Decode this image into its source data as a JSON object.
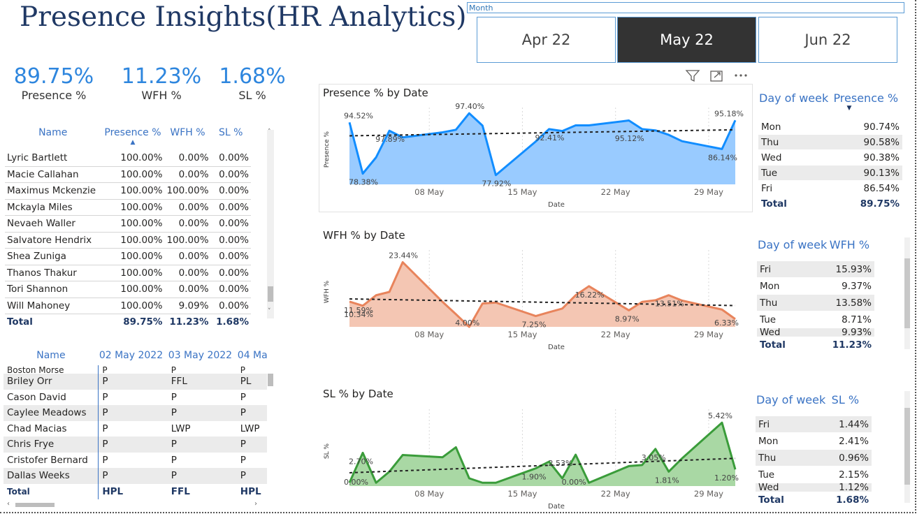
{
  "title": "Presence Insights(HR Analytics)",
  "month_slicer": {
    "label": "Month",
    "options": [
      "Apr 22",
      "May 22",
      "Jun 22"
    ],
    "selected": "May 22"
  },
  "kpis": [
    {
      "value": "89.75%",
      "label": "Presence %"
    },
    {
      "value": "11.23%",
      "label": "WFH %"
    },
    {
      "value": "1.68%",
      "label": "SL %"
    }
  ],
  "employee_table": {
    "columns": [
      "Name",
      "Presence %",
      "WFH %",
      "SL %"
    ],
    "rows": [
      [
        "Lyric Bartlett",
        "100.00%",
        "0.00%",
        "0.00%"
      ],
      [
        "Macie Callahan",
        "100.00%",
        "0.00%",
        "0.00%"
      ],
      [
        "Maximus Mckenzie",
        "100.00%",
        "100.00%",
        "0.00%"
      ],
      [
        "Mckayla Miles",
        "100.00%",
        "0.00%",
        "0.00%"
      ],
      [
        "Nevaeh Waller",
        "100.00%",
        "0.00%",
        "0.00%"
      ],
      [
        "Salvatore Hendrix",
        "100.00%",
        "100.00%",
        "0.00%"
      ],
      [
        "Shea Zuniga",
        "100.00%",
        "0.00%",
        "0.00%"
      ],
      [
        "Thanos Thakur",
        "100.00%",
        "0.00%",
        "0.00%"
      ],
      [
        "Tori Shannon",
        "100.00%",
        "0.00%",
        "0.00%"
      ],
      [
        "Will Mahoney",
        "100.00%",
        "9.09%",
        "0.00%"
      ]
    ],
    "total": [
      "Total",
      "89.75%",
      "11.23%",
      "1.68%"
    ]
  },
  "attendance_matrix": {
    "columns": [
      "Name",
      "02 May 2022",
      "03 May 2022",
      "04 Ma"
    ],
    "rows": [
      [
        "Boston Morse",
        "P",
        "P",
        "P"
      ],
      [
        "Briley Orr",
        "P",
        "FFL",
        "PL"
      ],
      [
        "Cason David",
        "P",
        "P",
        "P"
      ],
      [
        "Caylee Meadows",
        "P",
        "P",
        "P"
      ],
      [
        "Chad Macias",
        "P",
        "LWP",
        "LWP"
      ],
      [
        "Chris Frye",
        "P",
        "P",
        "P"
      ],
      [
        "Cristofer Bernard",
        "P",
        "P",
        "P"
      ],
      [
        "Dallas Weeks",
        "P",
        "P",
        "P"
      ]
    ],
    "total": [
      "Total",
      "HPL",
      "FFL",
      "HPL"
    ]
  },
  "chart_data": [
    {
      "type": "area",
      "title": "Presence % by Date",
      "xlabel": "Date",
      "ylabel": "Presence %",
      "x_ticks": [
        "08 May",
        "15 May",
        "22 May",
        "29 May"
      ],
      "color": "#118dff",
      "fill": "#99cbff",
      "ylim": [
        75,
        97
      ],
      "x_day_range": [
        2,
        31
      ],
      "x": [
        2,
        3,
        4,
        5,
        6,
        9,
        10,
        11,
        12,
        13,
        16,
        17,
        18,
        19,
        20,
        23,
        24,
        25,
        26,
        27,
        30,
        31
      ],
      "values": [
        94.52,
        78.38,
        83.5,
        91.89,
        89.8,
        91.4,
        92.2,
        97.4,
        93.5,
        77.92,
        88.5,
        92.41,
        91.8,
        93.6,
        93.6,
        95.12,
        92.4,
        92.0,
        90.6,
        88.6,
        86.14,
        95.18
      ],
      "point_labels": [
        {
          "x": 2,
          "y": 94.52,
          "text": "94.52%"
        },
        {
          "x": 3,
          "y": 78.38,
          "text": "78.38%"
        },
        {
          "x": 5,
          "y": 91.89,
          "text": "97.89%"
        },
        {
          "x": 11,
          "y": 97.4,
          "text": "97.40%"
        },
        {
          "x": 13,
          "y": 77.92,
          "text": "77.92%"
        },
        {
          "x": 17,
          "y": 92.41,
          "text": "92.41%"
        },
        {
          "x": 23,
          "y": 92.2,
          "text": "95.12%"
        },
        {
          "x": 30,
          "y": 86.14,
          "text": "86.14%"
        },
        {
          "x": 31,
          "y": 95.18,
          "text": "95.18%"
        }
      ],
      "trend": [
        90.3,
        92.2
      ]
    },
    {
      "type": "area",
      "title": "WFH % by Date",
      "xlabel": "Date",
      "ylabel": "WFH %",
      "x_ticks": [
        "08 May",
        "15 May",
        "22 May",
        "29 May"
      ],
      "color": "#e8845c",
      "fill": "#f4c6b3",
      "ylim": [
        4,
        25
      ],
      "x_day_range": [
        2,
        31
      ],
      "x": [
        2,
        3,
        4,
        5,
        6,
        9,
        10,
        11,
        12,
        13,
        16,
        17,
        18,
        19,
        20,
        23,
        24,
        25,
        26,
        27,
        30,
        31
      ],
      "values": [
        11.59,
        10.34,
        13.5,
        14.5,
        23.44,
        11.5,
        7.8,
        4.0,
        11.0,
        11.3,
        7.25,
        8.4,
        9.5,
        13.5,
        16.22,
        8.97,
        11.5,
        12.0,
        13.51,
        11.9,
        9.2,
        6.33
      ],
      "point_labels": [
        {
          "x": 2,
          "y": 11.59,
          "text": "11.59%"
        },
        {
          "x": 2,
          "y": 10.34,
          "text": "10.34%"
        },
        {
          "x": 6,
          "y": 23.44,
          "text": "23.44%"
        },
        {
          "x": 11,
          "y": 4.0,
          "text": "4.00%"
        },
        {
          "x": 16,
          "y": 7.25,
          "text": "7.25%"
        },
        {
          "x": 20,
          "y": 16.22,
          "text": "16.22%"
        },
        {
          "x": 23,
          "y": 8.97,
          "text": "8.97%"
        },
        {
          "x": 26,
          "y": 13.51,
          "text": "13.51%"
        },
        {
          "x": 31,
          "y": 6.33,
          "text": "6.33%"
        }
      ],
      "trend": [
        12.4,
        10.4
      ]
    },
    {
      "type": "area",
      "title": "SL % by Date",
      "xlabel": "Date",
      "ylabel": "SL %",
      "x_ticks": [
        "08 May",
        "15 May",
        "22 May",
        "29 May"
      ],
      "color": "#3a9c3a",
      "fill": "#a9d8a4",
      "ylim": [
        -0.3,
        6
      ],
      "x_day_range": [
        2,
        31
      ],
      "x": [
        2,
        3,
        4,
        5,
        6,
        9,
        10,
        11,
        12,
        13,
        16,
        17,
        18,
        19,
        20,
        23,
        24,
        25,
        26,
        27,
        30,
        31
      ],
      "values": [
        0.0,
        2.7,
        0.0,
        1.0,
        2.5,
        2.3,
        3.2,
        0.4,
        0.0,
        0.0,
        1.3,
        1.9,
        0.4,
        2.53,
        0.0,
        1.5,
        1.6,
        3.05,
        1.0,
        2.2,
        5.42,
        1.2
      ],
      "point_labels": [
        {
          "x": 2,
          "y": 0.0,
          "text": "0.00%"
        },
        {
          "x": 3,
          "y": 2.7,
          "text": "2.70%"
        },
        {
          "x": 16,
          "y": 1.3,
          "text": "1.90%"
        },
        {
          "x": 18,
          "y": 2.53,
          "text": "2.53%"
        },
        {
          "x": 19,
          "y": 0.4,
          "text": "0.00%"
        },
        {
          "x": 25,
          "y": 3.05,
          "text": "3.05%"
        },
        {
          "x": 26,
          "y": 1.0,
          "text": "1.81%"
        },
        {
          "x": 30,
          "y": 5.42,
          "text": "5.42%"
        },
        {
          "x": 31,
          "y": 1.2,
          "text": "1.20%"
        }
      ],
      "trend": [
        0.9,
        2.2
      ]
    }
  ],
  "dow_tables": [
    {
      "columns": [
        "Day of week",
        "Presence %"
      ],
      "rows": [
        [
          "Mon",
          "90.74%"
        ],
        [
          "Thu",
          "90.58%"
        ],
        [
          "Wed",
          "90.38%"
        ],
        [
          "Tue",
          "90.13%"
        ],
        [
          "Fri",
          "86.54%"
        ]
      ],
      "total": [
        "Total",
        "89.75%"
      ]
    },
    {
      "columns": [
        "Day of week",
        "WFH %"
      ],
      "rows": [
        [
          "Fri",
          "15.93%"
        ],
        [
          "Mon",
          "9.37%"
        ],
        [
          "Thu",
          "13.58%"
        ],
        [
          "Tue",
          "8.71%"
        ],
        [
          "Wed",
          "9.93%"
        ]
      ],
      "total": [
        "Total",
        "11.23%"
      ]
    },
    {
      "columns": [
        "Day of week",
        "SL %"
      ],
      "rows": [
        [
          "Fri",
          "1.44%"
        ],
        [
          "Mon",
          "2.41%"
        ],
        [
          "Thu",
          "0.96%"
        ],
        [
          "Tue",
          "2.15%"
        ],
        [
          "Wed",
          "1.12%"
        ]
      ],
      "total": [
        "Total",
        "1.68%"
      ]
    }
  ],
  "visual_header_icons": [
    "filter-icon",
    "focus-mode-icon",
    "more-options-icon"
  ]
}
